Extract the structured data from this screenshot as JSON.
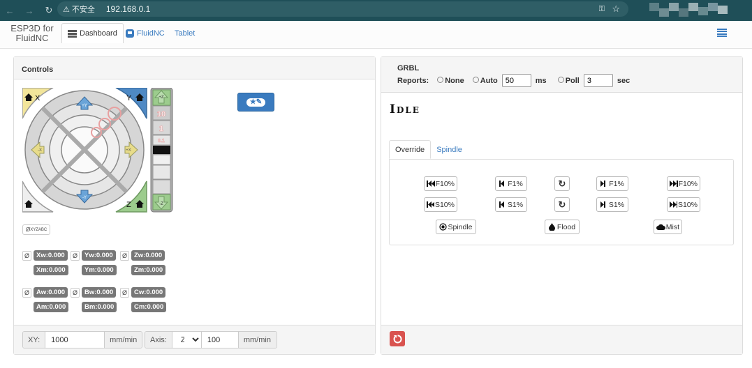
{
  "browser": {
    "url": "192.168.0.1",
    "security_label": "不安全",
    "back_icon": "arrow-left",
    "forward_icon": "arrow-right",
    "reload_icon": "reload"
  },
  "app": {
    "brand_line1": "ESP3D for",
    "brand_line2": "FluidNC",
    "tabs": [
      {
        "label": "Dashboard",
        "active": true
      },
      {
        "label": "FluidNC",
        "active": false
      },
      {
        "label": "Tablet",
        "active": false
      }
    ]
  },
  "controls": {
    "title": "Controls",
    "jog_labels": {
      "home_x": "X",
      "home_y": "Y",
      "home_z": "Z",
      "y_plus": "+Y",
      "y_minus": "-Y",
      "x_plus": "+X",
      "x_minus": "-X",
      "z_plus": "+Z",
      "z_minus": "-Z",
      "z_steps": [
        "10",
        "1",
        "0.1"
      ]
    },
    "zero_all_label": "Ø",
    "zero_all_suffix": "XYZABC",
    "zero_glyph": "Ø",
    "positions": [
      {
        "work": "Xw:0.000",
        "machine": "Xm:0.000"
      },
      {
        "work": "Yw:0.000",
        "machine": "Ym:0.000"
      },
      {
        "work": "Zw:0.000",
        "machine": "Zm:0.000"
      },
      {
        "work": "Aw:0.000",
        "machine": "Am:0.000"
      },
      {
        "work": "Bw:0.000",
        "machine": "Bm:0.000"
      },
      {
        "work": "Cw:0.000",
        "machine": "Cm:0.000"
      }
    ],
    "feed": {
      "xy_label": "XY:",
      "xy_value": "1000",
      "xy_unit": "mm/min",
      "axis_label": "Axis:",
      "axis_value": "Z",
      "axis_feed": "100",
      "axis_unit": "mm/min"
    }
  },
  "grbl": {
    "title": "GRBL",
    "reports_label": "Reports:",
    "none_label": "None",
    "auto_label": "Auto",
    "auto_value": "50",
    "auto_unit": "ms",
    "poll_label": "Poll",
    "poll_value": "3",
    "poll_unit": "sec",
    "state": "Idle",
    "tabs": [
      "Override",
      "Spindle"
    ],
    "overrides": {
      "f_minus10": "F10%",
      "f_minus1": "F1%",
      "f_plus1": "F1%",
      "f_plus10": "F10%",
      "s_minus10": "S10%",
      "s_minus1": "S1%",
      "s_plus1": "S1%",
      "s_plus10": "S10%",
      "spindle": "Spindle",
      "flood": "Flood",
      "mist": "Mist"
    },
    "colors": {
      "accent": "#3a7bbf",
      "danger": "#d9534f"
    }
  }
}
